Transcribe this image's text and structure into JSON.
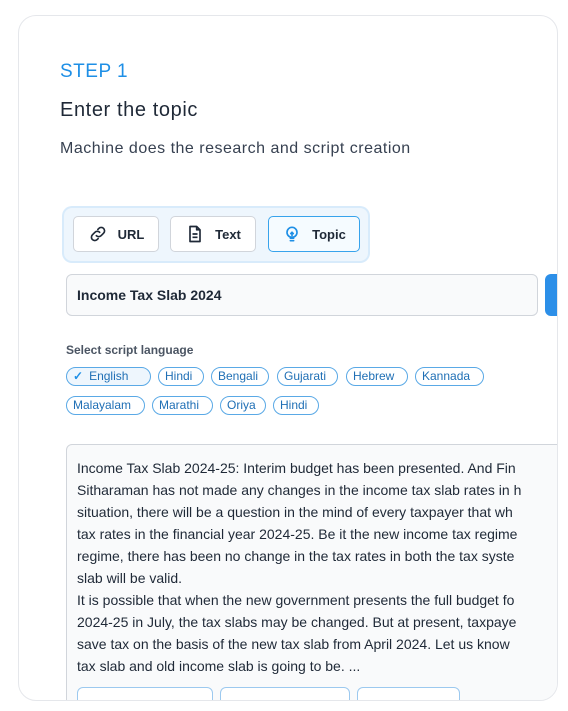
{
  "header": {
    "step": "STEP 1",
    "title": "Enter the topic",
    "subtitle": "Machine does the research and script creation"
  },
  "modes": [
    {
      "label": "URL",
      "icon": "link-icon"
    },
    {
      "label": "Text",
      "icon": "document-icon"
    },
    {
      "label": "Topic",
      "icon": "lightbulb-icon",
      "active": true
    }
  ],
  "topic_input": {
    "value": "Income Tax Slab 2024"
  },
  "language": {
    "label": "Select script language",
    "options": [
      "English",
      "Hindi",
      "Bengali",
      "Gujarati",
      "Hebrew",
      "Kannada",
      "Malayalam",
      "Marathi",
      "Oriya",
      "Hindi"
    ],
    "selected": "English"
  },
  "script": {
    "paragraph1": "Income Tax Slab 2024-25: Interim budget has been presented. And Fin\nSitharaman has not made any changes in the income tax slab rates in h\nsituation, there will be a question in the mind of every taxpayer that wh\ntax rates in the financial year 2024-25. Be it the new income tax regime\nregime, there has been no change in the tax rates in both the tax syste\nslab will be valid.",
    "paragraph2": "It is possible that when the new government presents the full budget fo\n2024-25 in July, the tax slabs may be changed. But at present, taxpaye\nsave tax on the basis of the new tax slab from April 2024. Let us know \ntax slab and old income slab is going to be. ..."
  },
  "colors": {
    "accent": "#1e8fe6",
    "chip_border": "#5aa9e6",
    "active_border": "#37a3ec"
  }
}
